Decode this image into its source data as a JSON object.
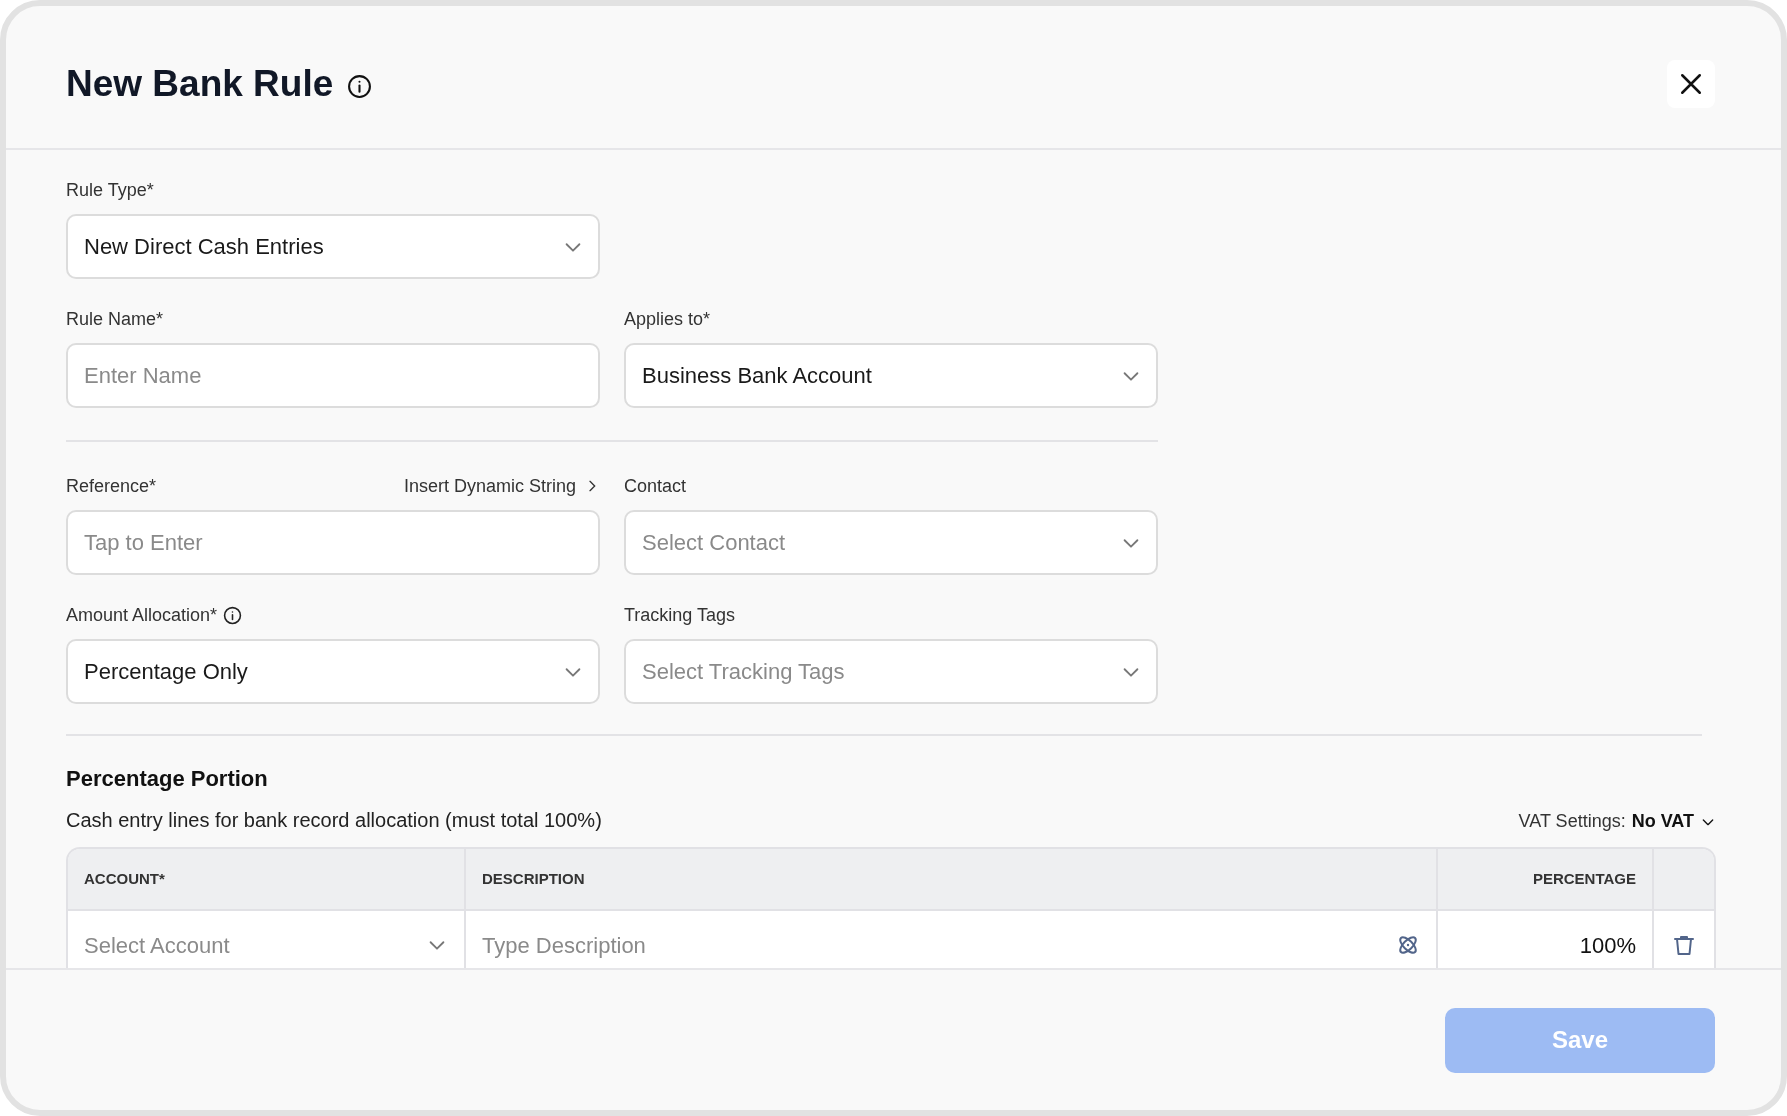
{
  "dialog": {
    "title": "New Bank Rule",
    "title_info": true
  },
  "form_rows": [
    {
      "fields": [
        {
          "kind": "select",
          "label": "Rule Type*",
          "value": "New Direct Cash Entries"
        }
      ]
    },
    {
      "fields": [
        {
          "kind": "input",
          "label": "Rule Name*",
          "placeholder": "Enter Name"
        },
        {
          "kind": "select",
          "label": "Applies to*",
          "value": "Business Bank Account"
        }
      ]
    },
    {
      "divider": true,
      "fields": [
        {
          "kind": "input",
          "label": "Reference*",
          "placeholder": "Tap to Enter",
          "action": "Insert Dynamic String"
        },
        {
          "kind": "select",
          "label": "Contact",
          "placeholder": "Select Contact"
        }
      ]
    },
    {
      "fields": [
        {
          "kind": "select",
          "label": "Amount Allocation*",
          "info": true,
          "value": "Percentage Only"
        },
        {
          "kind": "select",
          "label": "Tracking Tags",
          "placeholder": "Select Tracking Tags"
        }
      ]
    }
  ],
  "section": {
    "title": "Percentage Portion",
    "subtitle": "Cash entry lines for bank record allocation (must total 100%)",
    "vat_label": "VAT Settings:",
    "vat_value": "No VAT"
  },
  "table": {
    "columns": [
      {
        "label": "ACCOUNT*"
      },
      {
        "label": "DESCRIPTION"
      },
      {
        "label": "PERCENTAGE"
      }
    ],
    "rows": [
      {
        "account_placeholder": "Select Account",
        "description_placeholder": "Type Description",
        "percentage": "100%"
      }
    ]
  },
  "footer": {
    "save": {
      "label": "Save",
      "disabled": true
    }
  }
}
